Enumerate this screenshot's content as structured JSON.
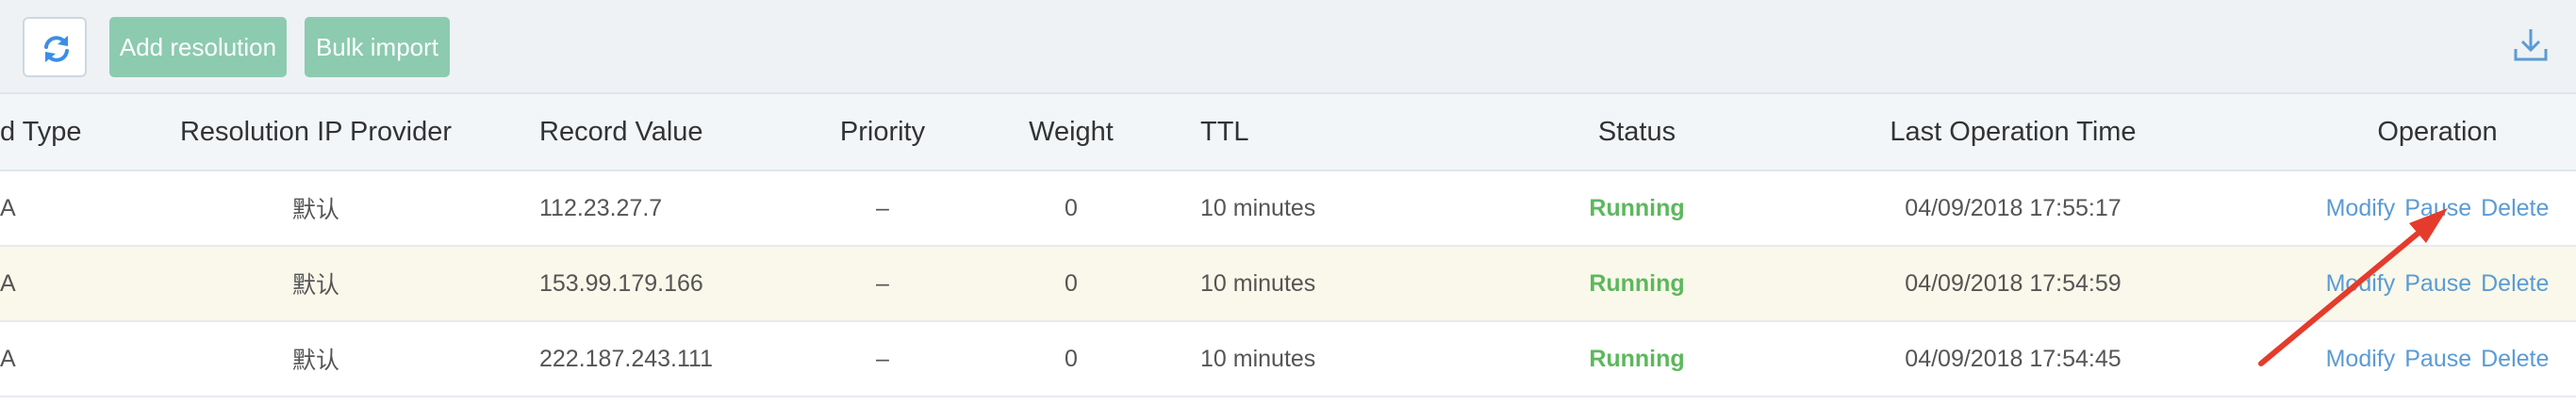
{
  "toolbar": {
    "refresh_icon": "refresh-icon",
    "add_label": "Add resolution",
    "bulk_label": "Bulk import",
    "download_icon": "download-icon"
  },
  "table": {
    "headers": {
      "type": "d Type",
      "provider": "Resolution IP Provider",
      "value": "Record Value",
      "priority": "Priority",
      "weight": "Weight",
      "ttl": "TTL",
      "status": "Status",
      "time": "Last Operation Time",
      "operation": "Operation"
    },
    "rows": [
      {
        "type": "A",
        "provider": "默认",
        "value": "112.23.27.7",
        "priority": "–",
        "weight": "0",
        "ttl": "10 minutes",
        "status": "Running",
        "time": "04/09/2018 17:55:17",
        "modify": "Modify",
        "pause": "Pause",
        "delete": "Delete"
      },
      {
        "type": "A",
        "provider": "默认",
        "value": "153.99.179.166",
        "priority": "–",
        "weight": "0",
        "ttl": "10 minutes",
        "status": "Running",
        "time": "04/09/2018 17:54:59",
        "modify": "Modify",
        "pause": "Pause",
        "delete": "Delete"
      },
      {
        "type": "A",
        "provider": "默认",
        "value": "222.187.243.111",
        "priority": "–",
        "weight": "0",
        "ttl": "10 minutes",
        "status": "Running",
        "time": "04/09/2018 17:54:45",
        "modify": "Modify",
        "pause": "Pause",
        "delete": "Delete"
      }
    ]
  },
  "colors": {
    "accent_button": "#8ccbb0",
    "link": "#5b9bd5",
    "status_running": "#5cb85c",
    "annotation_arrow": "#e53b2c"
  }
}
